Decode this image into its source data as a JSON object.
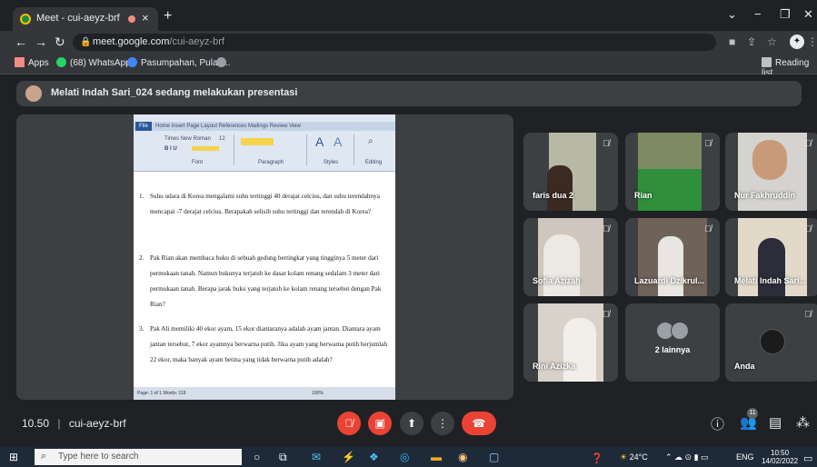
{
  "browser": {
    "tab_title": "Meet - cui-aeyz-brf",
    "tab_close": "×",
    "new_tab": "+",
    "url_host": "meet.google.com",
    "url_path": "/cui-aeyz-brf",
    "bookmarks": [
      "Apps",
      "(68) WhatsApp",
      "Pasumpahan, Pulau...",
      "Reading list"
    ]
  },
  "meet": {
    "presenter_text": "Melati Indah Sari_024 sedang melakukan presentasi",
    "time": "10.50",
    "meeting_code": "cui-aeyz-brf",
    "participant_count": "11",
    "more_count_label": "2 lainnya",
    "participants": [
      {
        "name": "faris dua 2"
      },
      {
        "name": "Rian"
      },
      {
        "name": "Nur Fakhruddin"
      },
      {
        "name": "Sofia Azizah"
      },
      {
        "name": "Lazuardi Dzikrul..."
      },
      {
        "name": "Melati Indah Sari..."
      },
      {
        "name": "Rini Azizka"
      },
      {
        "name": "Anda"
      }
    ]
  },
  "document": {
    "ribbon_tabs": "Home  Insert  Page Layout  References  Mailings  Review  View",
    "file_tab": "File",
    "font_name": "Times New Roman",
    "font_size": "12",
    "groups": [
      "Font",
      "Paragraph",
      "Styles",
      "Editing"
    ],
    "statusbar": "Page: 1 of 1   Words: 119",
    "zoom": "100%",
    "questions": [
      {
        "num": "1.",
        "text": "Suhu udara di Korea mengalami suhu tertinggi 40 derajat celcius, dan suhu terendahnya mencapai -7 derajat celcius. Berapakah selisih suhu tertinggi dan terendah di Korea?"
      },
      {
        "num": "2.",
        "text": "Pak Rian akan membaca buku di sebuah gedung bertingkat yang tingginya 5 meter dari permukaan tanah. Namun bukunya terjatuh ke dasar kolam renang sedalam 3 meter dari permukaan tanah. Berapa jarak buku yang terjatuh ke kolam renang tersebut dengan Pak Rian?"
      },
      {
        "num": "3.",
        "text": "Pak Ali memiliki 40 ekor ayam, 15 ekor diantaranya adalah ayam jantan. Diantara ayam jantan tersebut, 7 ekor ayamnya berwarna putih. Jika ayam yang berwarna putih berjumlah 22 ekor, maka banyak ayam betina yang tidak berwarna putih adalah?"
      }
    ]
  },
  "taskbar": {
    "search_placeholder": "Type here to search",
    "weather": "24°C",
    "lang": "ENG",
    "clock_time": "10:50",
    "clock_date": "14/02/2022"
  },
  "colors": {
    "meet_bg": "#202124",
    "tile_bg": "#3c4043",
    "end_call_red": "#ea4335"
  }
}
